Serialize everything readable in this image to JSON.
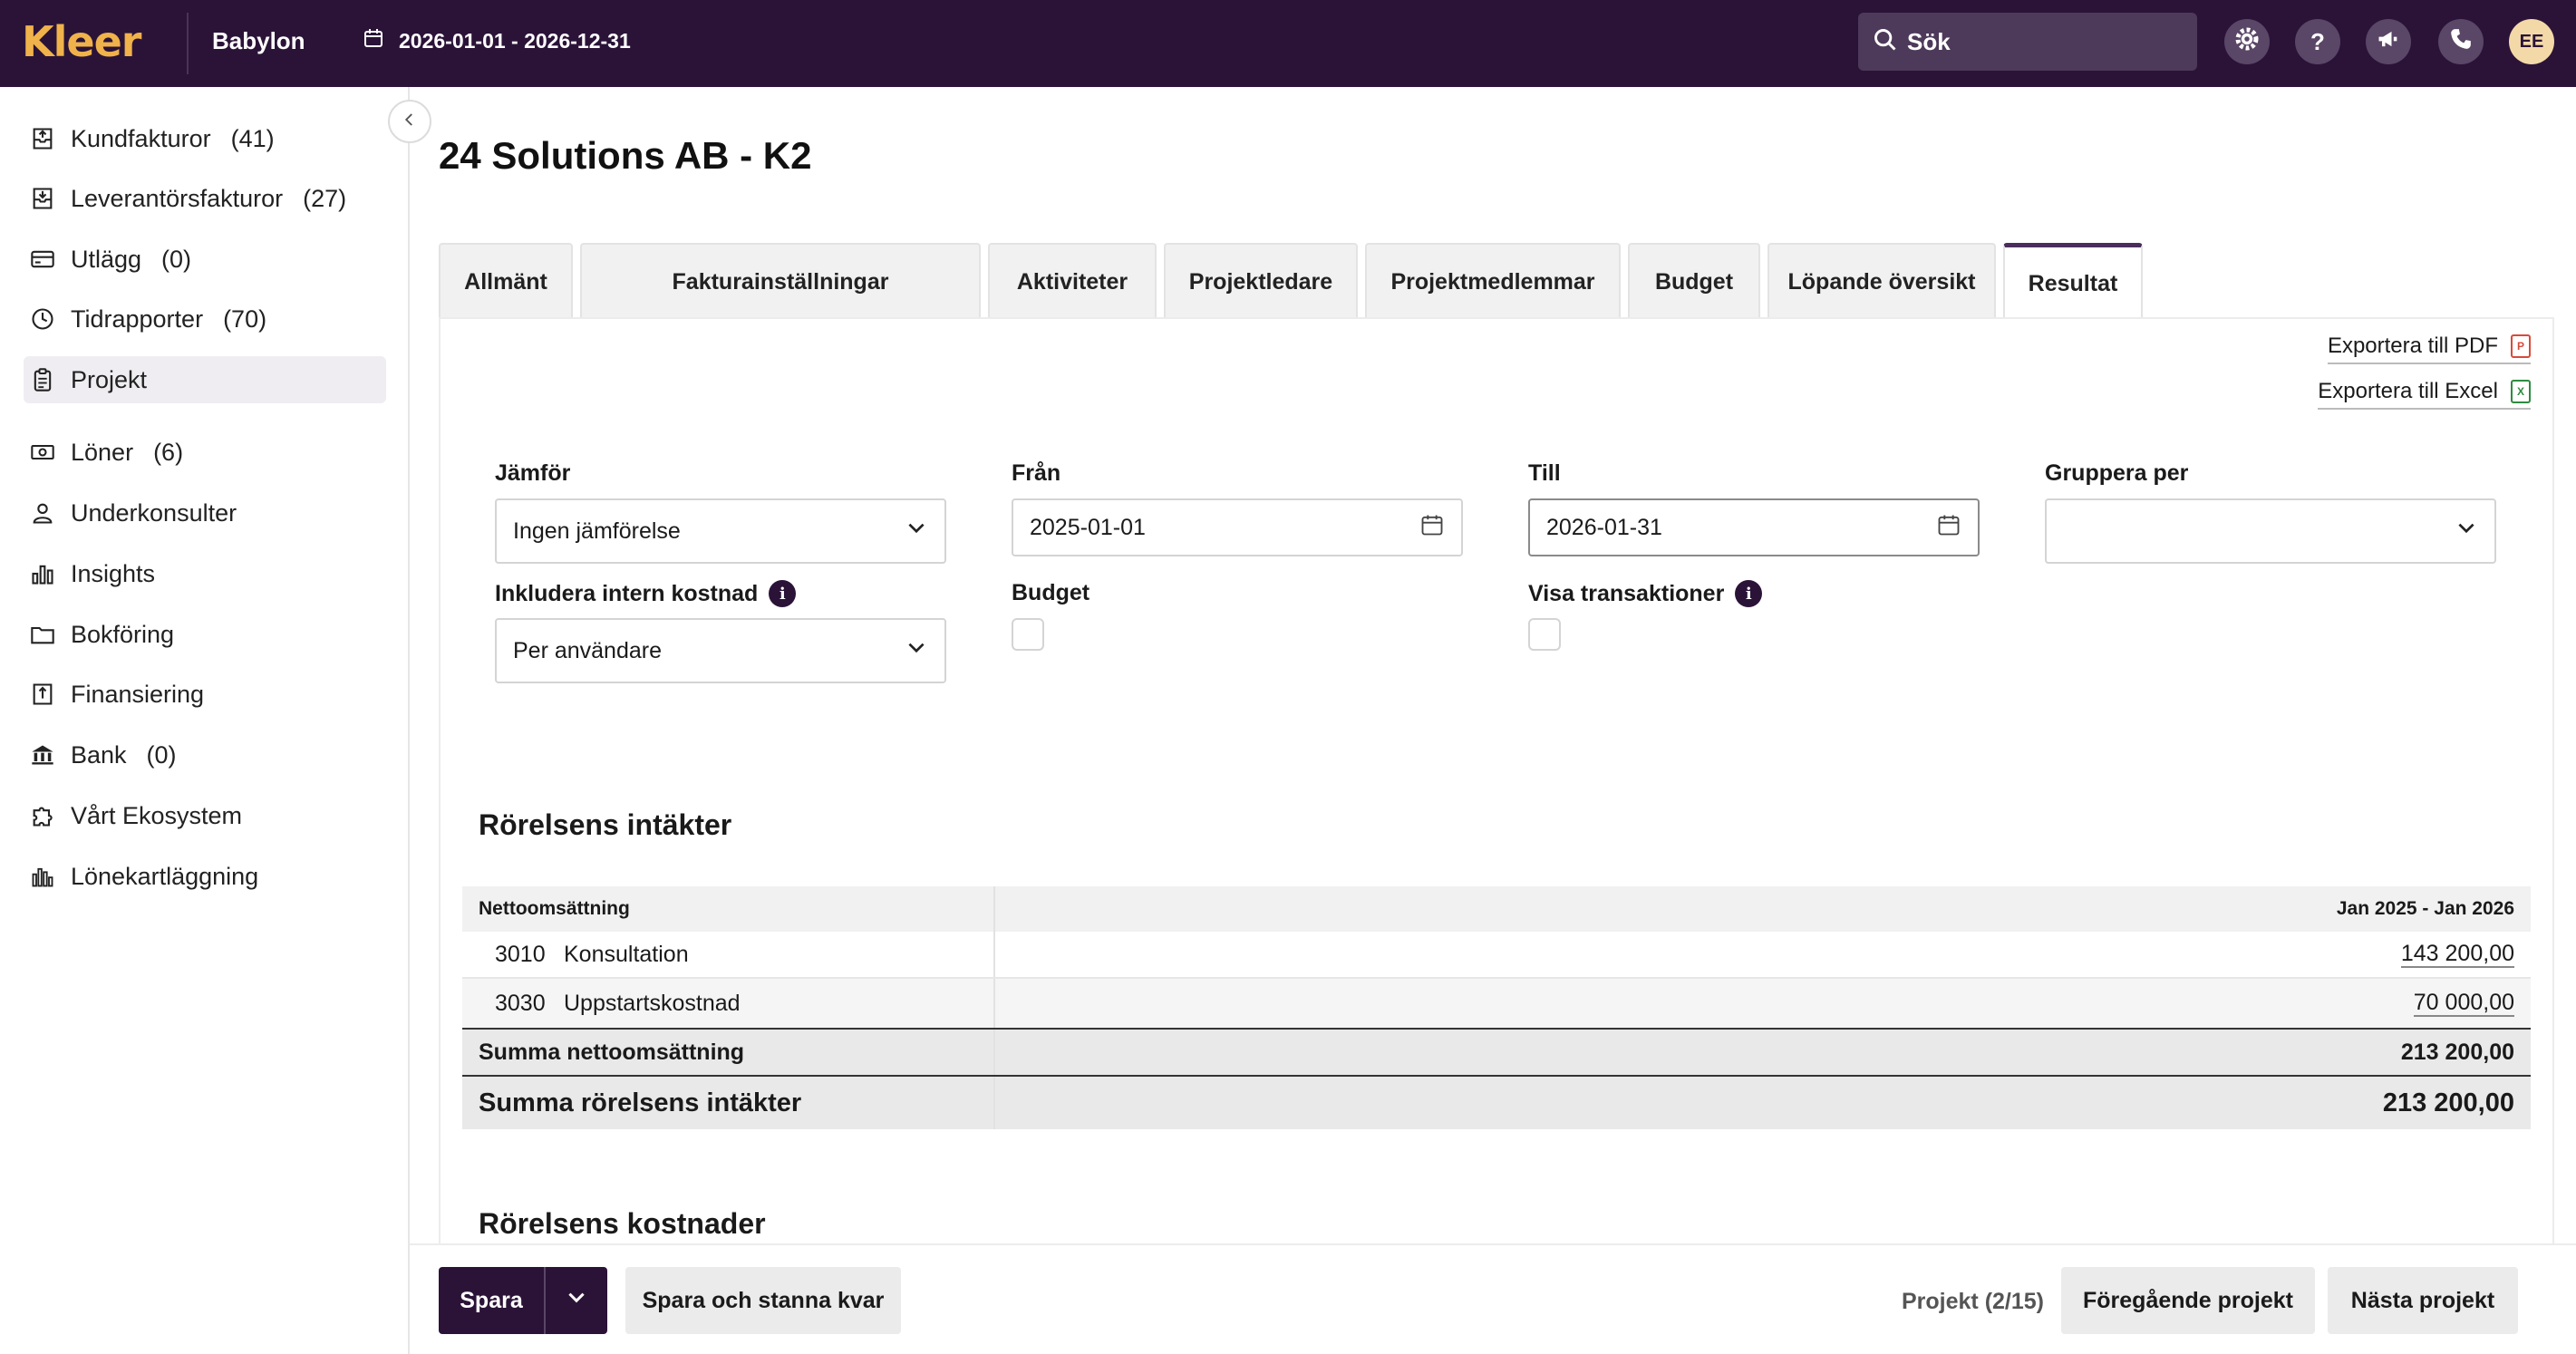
{
  "topbar": {
    "logo": "Kleer",
    "company": "Babylon",
    "period": "2026-01-01 - 2026-12-31",
    "search_placeholder": "Sök",
    "avatar_initials": "EE",
    "brand_color": "#2b1338",
    "logo_color": "#f0b24a"
  },
  "sidebar": {
    "items": [
      {
        "label": "Kundfakturor",
        "count": "(41)",
        "icon": "invoice-out-icon"
      },
      {
        "label": "Leverantörsfakturor",
        "count": "(27)",
        "icon": "invoice-in-icon"
      },
      {
        "label": "Utlägg",
        "count": "(0)",
        "icon": "card-icon"
      },
      {
        "label": "Tidrapporter",
        "count": "(70)",
        "icon": "clock-icon"
      },
      {
        "label": "Projekt",
        "count": "",
        "icon": "clipboard-icon",
        "active": true
      },
      {
        "label": "Löner",
        "count": "(6)",
        "icon": "money-icon"
      },
      {
        "label": "Underkonsulter",
        "count": "",
        "icon": "user-icon"
      },
      {
        "label": "Insights",
        "count": "",
        "icon": "bar-chart-icon"
      },
      {
        "label": "Bokföring",
        "count": "",
        "icon": "folder-icon"
      },
      {
        "label": "Finansiering",
        "count": "",
        "icon": "finance-icon"
      },
      {
        "label": "Bank",
        "count": "(0)",
        "icon": "bank-icon"
      },
      {
        "label": "Vårt Ekosystem",
        "count": "",
        "icon": "puzzle-icon"
      },
      {
        "label": "Lönekartläggning",
        "count": "",
        "icon": "salary-chart-icon"
      }
    ]
  },
  "page": {
    "title": "24 Solutions AB - K2"
  },
  "tabs": [
    {
      "label": "Allmänt"
    },
    {
      "label": "Fakturainställningar"
    },
    {
      "label": "Aktiviteter"
    },
    {
      "label": "Projektledare"
    },
    {
      "label": "Projektmedlemmar"
    },
    {
      "label": "Budget"
    },
    {
      "label": "Löpande översikt"
    },
    {
      "label": "Resultat",
      "active": true
    }
  ],
  "exports": {
    "pdf_label": "Exportera till PDF",
    "excel_label": "Exportera till Excel"
  },
  "filters": {
    "compare_label": "Jämför",
    "compare_value": "Ingen jämförelse",
    "from_label": "Från",
    "from_value": "2025-01-01",
    "to_label": "Till",
    "to_value": "2026-01-31",
    "group_label": "Gruppera per",
    "group_value": "",
    "internal_cost_label": "Inkludera intern kostnad",
    "internal_cost_value": "Per användare",
    "budget_label": "Budget",
    "budget_checked": false,
    "show_transactions_label": "Visa transaktioner",
    "show_transactions_checked": false
  },
  "report": {
    "income_title": "Rörelsens intäkter",
    "table_header_left": "Nettoomsättning",
    "table_header_right": "Jan 2025 - Jan 2026",
    "rows": [
      {
        "account": "3010",
        "name": "Konsultation",
        "value": "143 200,00"
      },
      {
        "account": "3030",
        "name": "Uppstartskostnad",
        "value": "70 000,00"
      }
    ],
    "sum_net_label": "Summa nettoomsättning",
    "sum_net_value": "213 200,00",
    "sum_income_label": "Summa rörelsens intäkter",
    "sum_income_value": "213 200,00",
    "costs_title": "Rörelsens kostnader"
  },
  "footer": {
    "save_label": "Spara",
    "save_stay_label": "Spara och stanna kvar",
    "pager_text": "Projekt (2/15)",
    "prev_label": "Föregående projekt",
    "next_label": "Nästa projekt"
  }
}
